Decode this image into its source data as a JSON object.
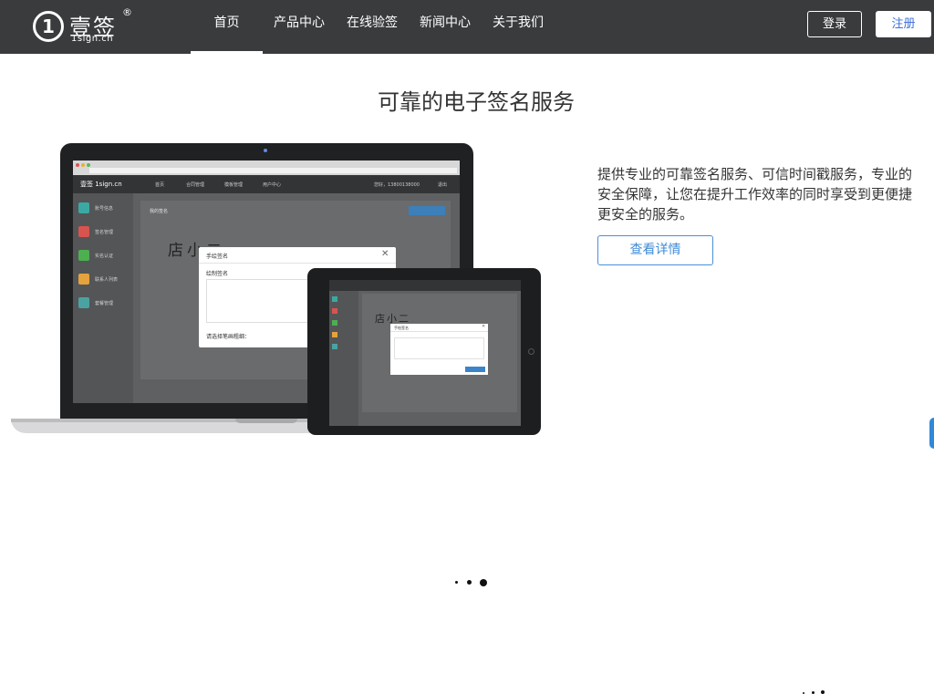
{
  "header": {
    "logo": {
      "mark": "1",
      "name": "壹签",
      "reg": "®",
      "domain": "1sign.cn"
    },
    "nav": [
      "首页",
      "产品中心",
      "在线验签",
      "新闻中心",
      "关于我们"
    ],
    "active_nav": "首页",
    "login": "登录",
    "register": "注册"
  },
  "hero": {
    "title": "可靠的电子签名服务",
    "description": "提供专业的可靠签名服务、可信时间戳服务，专业的安全保障，让您在提升工作效率的同时享受到更便捷更安全的服务。",
    "details_button": "查看详情"
  },
  "mockup": {
    "app_logo": "壹签 1sign.cn",
    "app_nav": [
      "首页",
      "合同管理",
      "模板管理",
      "用户中心"
    ],
    "app_user": "您好，13800138000",
    "app_logout": "退出",
    "sidebar": [
      "账号信息",
      "签名管理",
      "实名认证",
      "联系人列表",
      "套餐管理"
    ],
    "page_title": "我的签名",
    "signature": "店小二",
    "dialog": {
      "title": "手绘签名",
      "label": "绘制签名",
      "pen_label": "请选择笔画粗细：",
      "close": "✕"
    }
  },
  "colors": {
    "header_bg": "#3a3b3d",
    "accent": "#3f8bd6",
    "sidebar_icons": [
      "#3aa9a3",
      "#d9534f",
      "#4caf50",
      "#e6a23c",
      "#4aa3a0"
    ]
  }
}
